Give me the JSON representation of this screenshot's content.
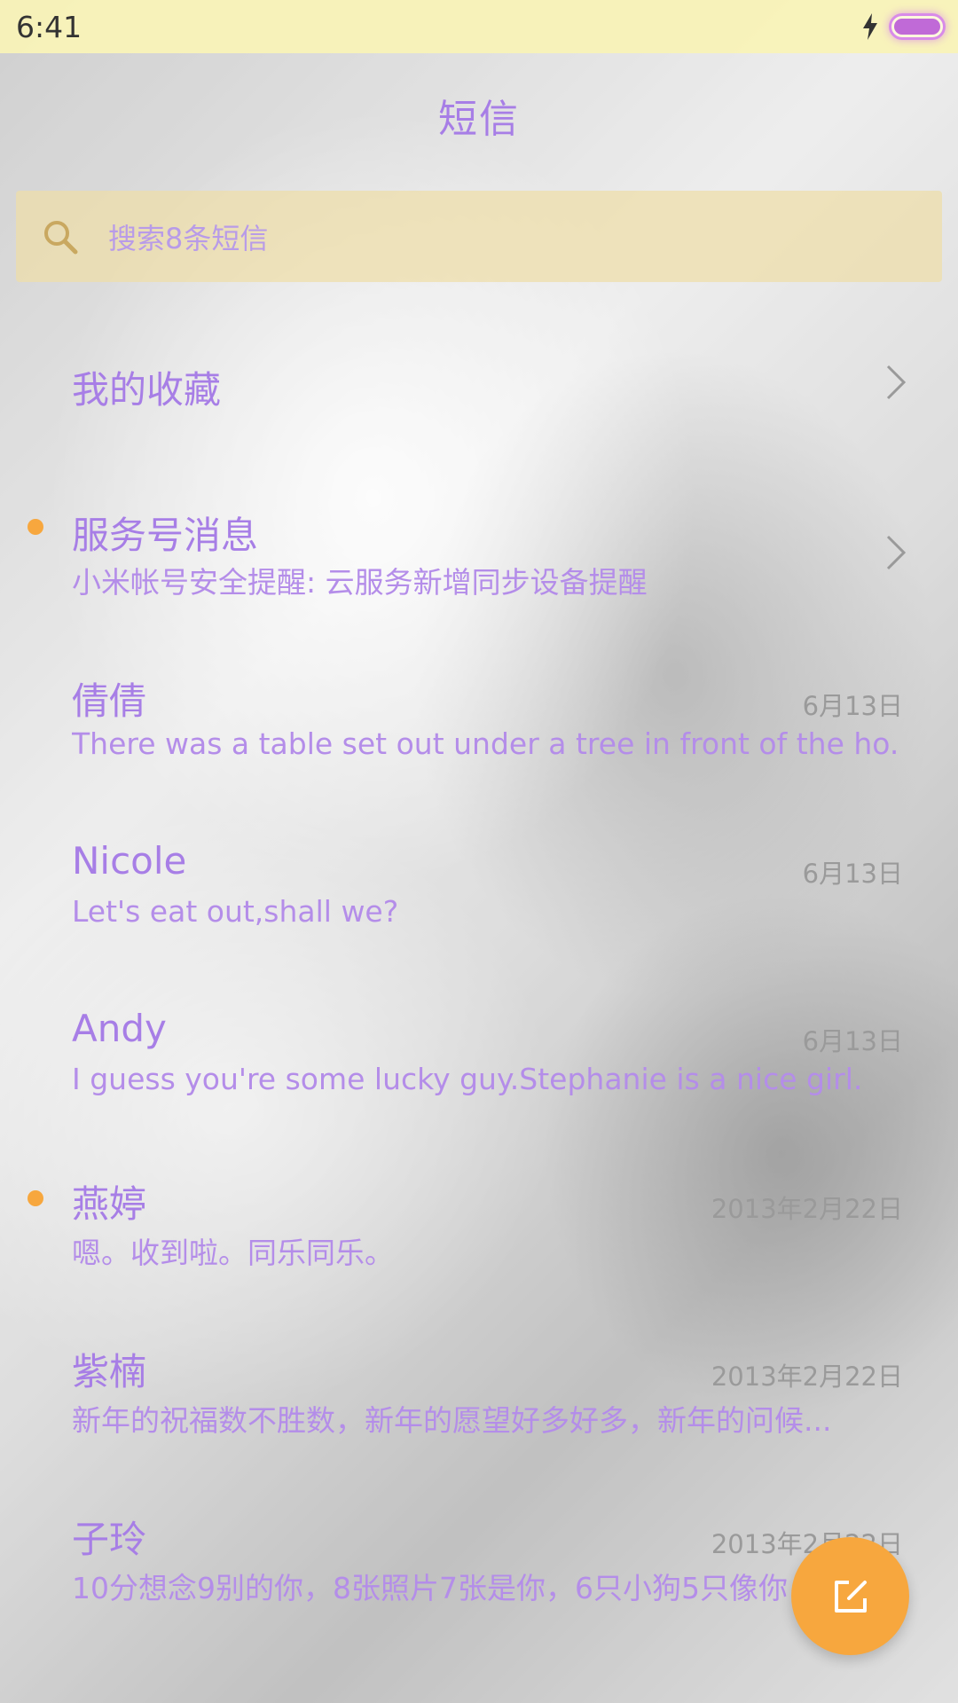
{
  "status_bar": {
    "time": "6:41",
    "charging_icon": "bolt-icon",
    "battery_icon": "battery-icon",
    "battery_level": 1.0
  },
  "header": {
    "title": "短信"
  },
  "search": {
    "icon": "search-icon",
    "placeholder": "搜索8条短信"
  },
  "favorites": {
    "label": "我的收藏",
    "icon": "chevron-right-icon"
  },
  "service": {
    "title": "服务号消息",
    "subtitle": "小米帐号安全提醒: 云服务新增同步设备提醒",
    "unread": true,
    "icon": "chevron-right-icon"
  },
  "conversations": [
    {
      "name": "倩倩",
      "date": "6月13日",
      "preview": "There was a table set out under a tree in front of the ho...",
      "unread": false
    },
    {
      "name": "Nicole",
      "date": "6月13日",
      "preview": "Let's eat out,shall we?",
      "unread": false
    },
    {
      "name": "Andy",
      "date": "6月13日",
      "preview": "I guess you're some lucky guy.Stephanie is a nice girl.",
      "unread": false
    },
    {
      "name": "燕婷",
      "date": "2013年2月22日",
      "preview": "嗯。收到啦。同乐同乐。",
      "unread": true
    },
    {
      "name": "紫楠",
      "date": "2013年2月22日",
      "preview": "新年的祝福数不胜数，新年的愿望好多好多，新年的问候...",
      "unread": false
    },
    {
      "name": "子玲",
      "date": "2013年2月22日",
      "preview": "10分想念9别的你，8张照片7张是你，6只小狗5只像你",
      "unread": false
    }
  ],
  "compose": {
    "icon": "compose-icon"
  },
  "colors": {
    "accent": "#a77ee6",
    "unread_dot": "#f7a73e",
    "fab": "#f7a73e",
    "status_bar": "#f8f2b8",
    "search_bg": "#eedea8"
  }
}
